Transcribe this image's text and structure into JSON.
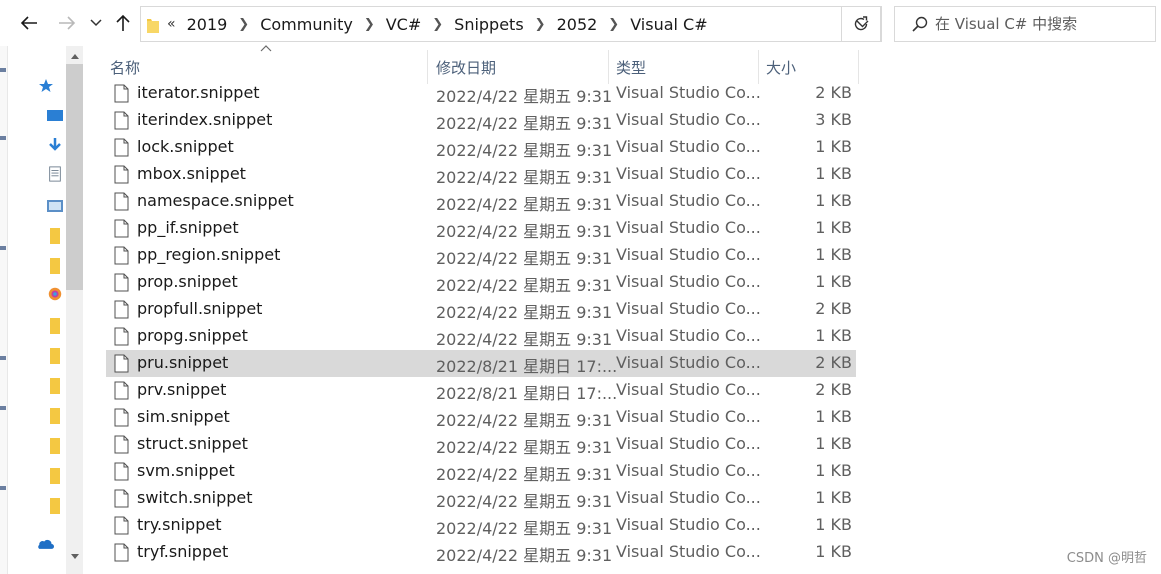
{
  "nav": {
    "back_icon": "arrow-left-icon",
    "forward_icon": "arrow-right-icon",
    "recent_icon": "chevron-down-icon",
    "up_icon": "arrow-up-icon"
  },
  "address": {
    "overflow": "«",
    "crumbs": [
      "2019",
      "Community",
      "VC#",
      "Snippets",
      "2052",
      "Visual C#"
    ]
  },
  "search": {
    "placeholder": "在 Visual C# 中搜索"
  },
  "columns": {
    "name": "名称",
    "date": "修改日期",
    "type": "类型",
    "size": "大小"
  },
  "files": [
    {
      "name": "iterator.snippet",
      "date": "2022/4/22 星期五 9:31",
      "type": "Visual Studio Co...",
      "size": "2 KB"
    },
    {
      "name": "iterindex.snippet",
      "date": "2022/4/22 星期五 9:31",
      "type": "Visual Studio Co...",
      "size": "3 KB"
    },
    {
      "name": "lock.snippet",
      "date": "2022/4/22 星期五 9:31",
      "type": "Visual Studio Co...",
      "size": "1 KB"
    },
    {
      "name": "mbox.snippet",
      "date": "2022/4/22 星期五 9:31",
      "type": "Visual Studio Co...",
      "size": "1 KB"
    },
    {
      "name": "namespace.snippet",
      "date": "2022/4/22 星期五 9:31",
      "type": "Visual Studio Co...",
      "size": "1 KB"
    },
    {
      "name": "pp_if.snippet",
      "date": "2022/4/22 星期五 9:31",
      "type": "Visual Studio Co...",
      "size": "1 KB"
    },
    {
      "name": "pp_region.snippet",
      "date": "2022/4/22 星期五 9:31",
      "type": "Visual Studio Co...",
      "size": "1 KB"
    },
    {
      "name": "prop.snippet",
      "date": "2022/4/22 星期五 9:31",
      "type": "Visual Studio Co...",
      "size": "1 KB"
    },
    {
      "name": "propfull.snippet",
      "date": "2022/4/22 星期五 9:31",
      "type": "Visual Studio Co...",
      "size": "2 KB"
    },
    {
      "name": "propg.snippet",
      "date": "2022/4/22 星期五 9:31",
      "type": "Visual Studio Co...",
      "size": "1 KB"
    },
    {
      "name": "pru.snippet",
      "date": "2022/8/21 星期日 17:...",
      "type": "Visual Studio Co...",
      "size": "2 KB",
      "selected": true
    },
    {
      "name": "prv.snippet",
      "date": "2022/8/21 星期日 17:...",
      "type": "Visual Studio Co...",
      "size": "2 KB"
    },
    {
      "name": "sim.snippet",
      "date": "2022/4/22 星期五 9:31",
      "type": "Visual Studio Co...",
      "size": "1 KB"
    },
    {
      "name": "struct.snippet",
      "date": "2022/4/22 星期五 9:31",
      "type": "Visual Studio Co...",
      "size": "1 KB"
    },
    {
      "name": "svm.snippet",
      "date": "2022/4/22 星期五 9:31",
      "type": "Visual Studio Co...",
      "size": "1 KB"
    },
    {
      "name": "switch.snippet",
      "date": "2022/4/22 星期五 9:31",
      "type": "Visual Studio Co...",
      "size": "1 KB"
    },
    {
      "name": "try.snippet",
      "date": "2022/4/22 星期五 9:31",
      "type": "Visual Studio Co...",
      "size": "1 KB"
    },
    {
      "name": "tryf.snippet",
      "date": "2022/4/22 星期五 9:31",
      "type": "Visual Studio Co...",
      "size": "1 KB"
    }
  ],
  "navpane_icons": [
    "pin-star-icon",
    "desktop-icon",
    "download-icon",
    "document-icon",
    "picture-icon",
    "folder-icon",
    "folder-icon",
    "photos-icon",
    "folder-icon",
    "folder-icon",
    "folder-icon",
    "folder-icon",
    "folder-icon",
    "folder-icon",
    "folder-icon",
    "onedrive-icon"
  ],
  "watermark": "CSDN @明哲",
  "colors": {
    "selected_row": "#d9d9d9",
    "column_header": "#4c607a",
    "folder": "#f4c842"
  }
}
